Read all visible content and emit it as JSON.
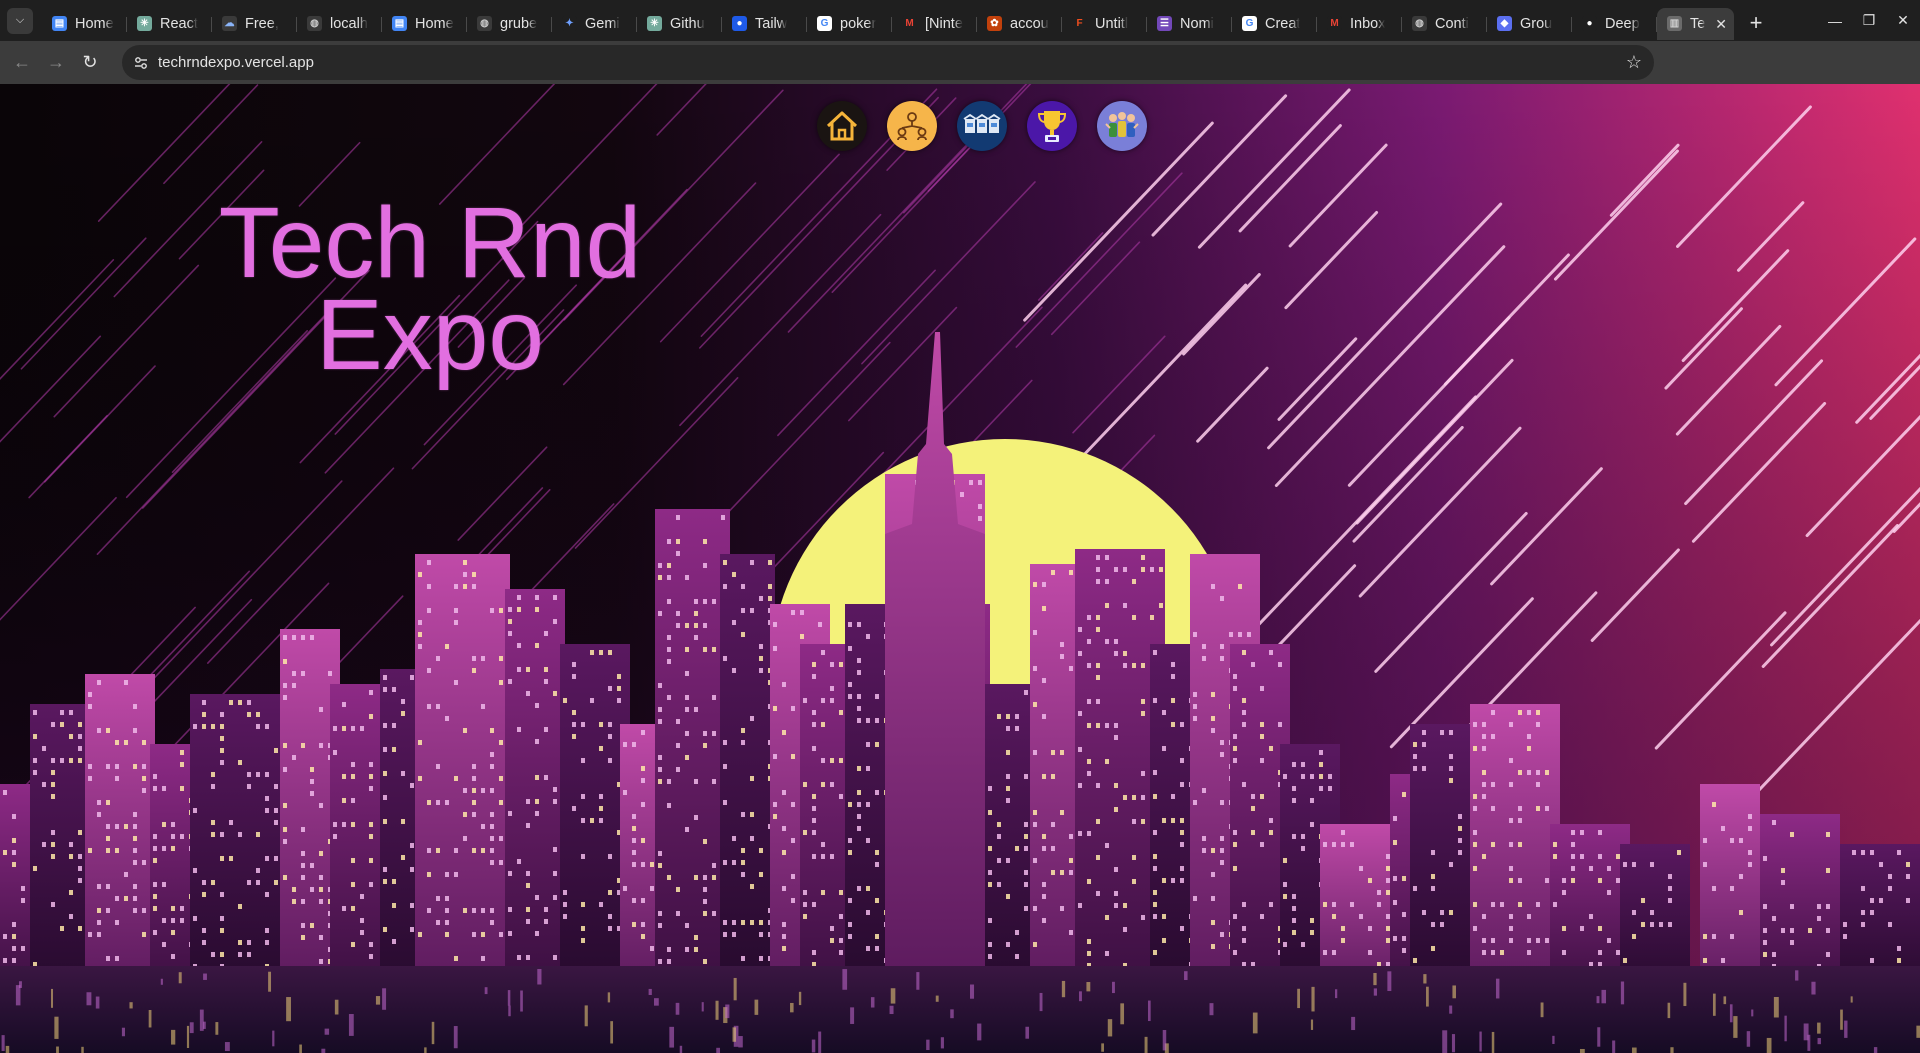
{
  "browser": {
    "tabs": [
      {
        "title": "Home",
        "icon": "doc-icon",
        "color": "#4285f4"
      },
      {
        "title": "React",
        "icon": "chatgpt-icon",
        "color": "#74aa9c"
      },
      {
        "title": "Free,",
        "icon": "cloud-icon",
        "color": "#3a3a3a"
      },
      {
        "title": "localh",
        "icon": "globe-icon",
        "color": "#3a3a3a"
      },
      {
        "title": "Home",
        "icon": "doc-icon",
        "color": "#4285f4"
      },
      {
        "title": "grube",
        "icon": "globe-icon",
        "color": "#3a3a3a"
      },
      {
        "title": "Gemi",
        "icon": "gemini-icon",
        "color": "#1f1f1f"
      },
      {
        "title": "Githu",
        "icon": "chatgpt-icon",
        "color": "#74aa9c"
      },
      {
        "title": "Tailw",
        "icon": "tailwind-icon",
        "color": "#1e5ae8"
      },
      {
        "title": "poker",
        "icon": "google-icon",
        "color": "#ffffff"
      },
      {
        "title": "[Ninte",
        "icon": "gmail-icon",
        "color": "#1f1f1f"
      },
      {
        "title": "accou",
        "icon": "puzzle-icon",
        "color": "#c2410c"
      },
      {
        "title": "Untitl",
        "icon": "figma-icon",
        "color": "#1f1f1f"
      },
      {
        "title": "Nomi",
        "icon": "form-icon",
        "color": "#7248b9"
      },
      {
        "title": "Creat",
        "icon": "google-icon",
        "color": "#ffffff"
      },
      {
        "title": "Inbox",
        "icon": "gmail-icon",
        "color": "#1f1f1f"
      },
      {
        "title": "Conti",
        "icon": "globe-icon",
        "color": "#3a3a3a"
      },
      {
        "title": "Grou",
        "icon": "chat-icon",
        "color": "#5b6ff0"
      },
      {
        "title": "Deep",
        "icon": "github-icon",
        "color": "#1f1f1f"
      },
      {
        "title": "Te",
        "icon": "city-icon",
        "color": "#6b6b6b",
        "active": true
      }
    ],
    "url": "techrndexpo.vercel.app"
  },
  "site": {
    "title_line1": "Tech Rnd",
    "title_line2": "Expo",
    "nav": [
      {
        "name": "home-nav-icon",
        "icon": "house-icon",
        "bg": "#1a1412"
      },
      {
        "name": "team-nav-icon",
        "icon": "people-network-icon",
        "bg": "#f6b54a"
      },
      {
        "name": "events-nav-icon",
        "icon": "event-booths-icon",
        "bg": "#123a72"
      },
      {
        "name": "awards-nav-icon",
        "icon": "trophy-icon",
        "bg": "#4b17a8"
      },
      {
        "name": "contact-nav-icon",
        "icon": "group-people-icon",
        "bg": "#7a7fd8"
      }
    ]
  },
  "colors": {
    "title": "#e26fe0",
    "sun": "#f4f27a",
    "sky_right": "#e0306f",
    "sky_mid": "#6a1a6e"
  }
}
